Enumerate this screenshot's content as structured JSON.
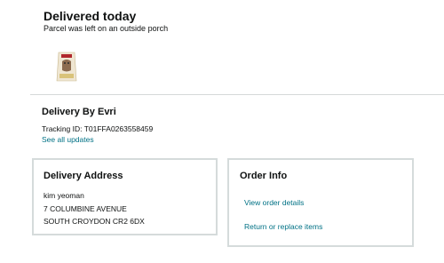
{
  "status": {
    "title": "Delivered today",
    "subtitle": "Parcel was left on an outside porch"
  },
  "product": {
    "icon": "cat-food-bag-icon"
  },
  "carrier": {
    "title": "Delivery By Evri",
    "tracking": "Tracking ID: T01FFA0263558459",
    "see_all": "See all updates"
  },
  "address": {
    "title": "Delivery Address",
    "lines": [
      "kim yeoman",
      "7 COLUMBINE AVENUE",
      "SOUTH CROYDON CR2 6DX"
    ]
  },
  "order_info": {
    "title": "Order Info",
    "view_details": "View order details",
    "return_replace": "Return or replace items"
  },
  "colors": {
    "link": "#007185",
    "border": "#d5dbdb"
  }
}
